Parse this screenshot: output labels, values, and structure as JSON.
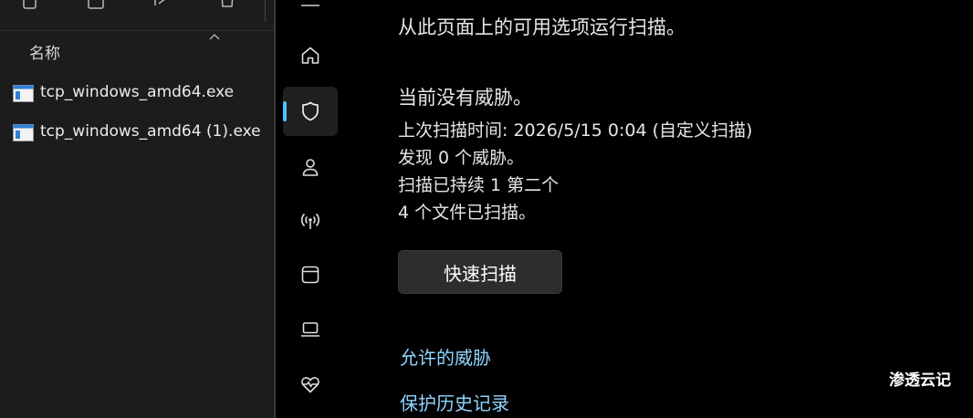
{
  "explorer": {
    "column_header": "名称",
    "files": [
      {
        "name": "tcp_windows_amd64.exe",
        "icon": "exe-file-icon"
      },
      {
        "name": "tcp_windows_amd64 (1).exe",
        "icon": "exe-file-icon"
      }
    ]
  },
  "nav": {
    "items": [
      {
        "id": "home",
        "icon": "home-icon"
      },
      {
        "id": "virus-protection",
        "icon": "shield-icon",
        "selected": true
      },
      {
        "id": "account",
        "icon": "person-icon"
      },
      {
        "id": "firewall",
        "icon": "antenna-icon"
      },
      {
        "id": "app-browser",
        "icon": "window-icon"
      },
      {
        "id": "device-security",
        "icon": "laptop-icon"
      },
      {
        "id": "device-health",
        "icon": "heart-pulse-icon"
      }
    ],
    "accent_color": "#4cc2ff"
  },
  "main": {
    "description": "从此页面上的可用选项运行扫描。",
    "status": "当前没有威胁。",
    "last_scan": "上次扫描时间: 2026/5/15 0:04 (自定义扫描)",
    "threats_found": "发现 0 个威胁。",
    "duration": "扫描已持续 1 第二个",
    "files_scanned": "4 个文件已扫描。",
    "quick_scan_label": "快速扫描",
    "links": {
      "allowed_threats": "允许的威胁",
      "protection_history": "保护历史记录"
    }
  },
  "watermark": "渗透云记"
}
